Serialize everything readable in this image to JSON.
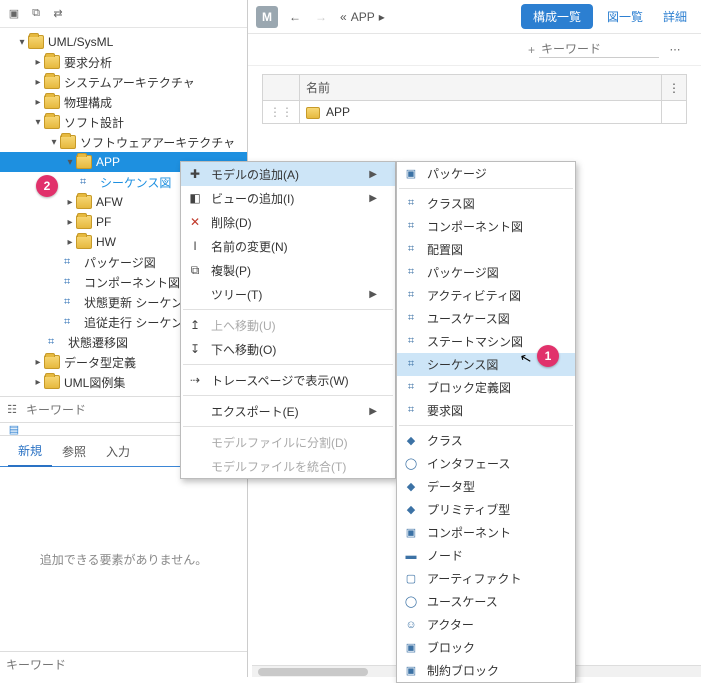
{
  "tree": {
    "root": "UML/SysML",
    "items": [
      "要求分析",
      "システムアーキテクチャ",
      "物理構成",
      "ソフト設計",
      "ソフトウェアアーキテクチャ",
      "APP",
      "シーケンス図",
      "AFW",
      "PF",
      "HW",
      "パッケージ図",
      "コンポーネント図",
      "状態更新 シーケンス図",
      "追従走行 シーケンス図",
      "状態遷移図",
      "データ型定義",
      "UML図例集"
    ]
  },
  "keyword_placeholder": "キーワード",
  "lower_tabs": {
    "new": "新規",
    "ref": "参照",
    "input": "入力"
  },
  "lower_empty": "追加できる要素がありません。",
  "right": {
    "m": "M",
    "back_glyph": "←",
    "fwd_glyph": "→",
    "breadcrumb_pre": "«",
    "breadcrumb_app": "APP",
    "breadcrumb_caret": "▸",
    "btn_list": "構成一覧",
    "link_diagrams": "図一覧",
    "link_detail": "詳細",
    "search_plus": "+",
    "search_placeholder": "キーワード",
    "col_name": "名前",
    "row_app": "APP",
    "drag_glyph": "⋮"
  },
  "ctx": {
    "add_model": "モデルの追加(A)",
    "add_view": "ビューの追加(I)",
    "delete": "削除(D)",
    "rename": "名前の変更(N)",
    "dup": "複製(P)",
    "tree": "ツリー(T)",
    "move_up": "上へ移動(U)",
    "move_down": "下へ移動(O)",
    "trace": "トレースページで表示(W)",
    "export": "エクスポート(E)",
    "split": "モデルファイルに分割(D)",
    "merge": "モデルファイルを統合(T)"
  },
  "ctx2": {
    "package": "パッケージ",
    "class_d": "クラス図",
    "component_d": "コンポーネント図",
    "deploy_d": "配置図",
    "package_d": "パッケージ図",
    "activity_d": "アクティビティ図",
    "usecase_d": "ユースケース図",
    "state_d": "ステートマシン図",
    "sequence_d": "シーケンス図",
    "blockdef_d": "ブロック定義図",
    "req_d": "要求図",
    "class": "クラス",
    "interface": "インタフェース",
    "datatype": "データ型",
    "primitive": "プリミティブ型",
    "component": "コンポーネント",
    "node": "ノード",
    "artifact": "アーティファクト",
    "usecase": "ユースケース",
    "actor": "アクター",
    "block": "ブロック",
    "constraint_block": "制約ブロック"
  }
}
